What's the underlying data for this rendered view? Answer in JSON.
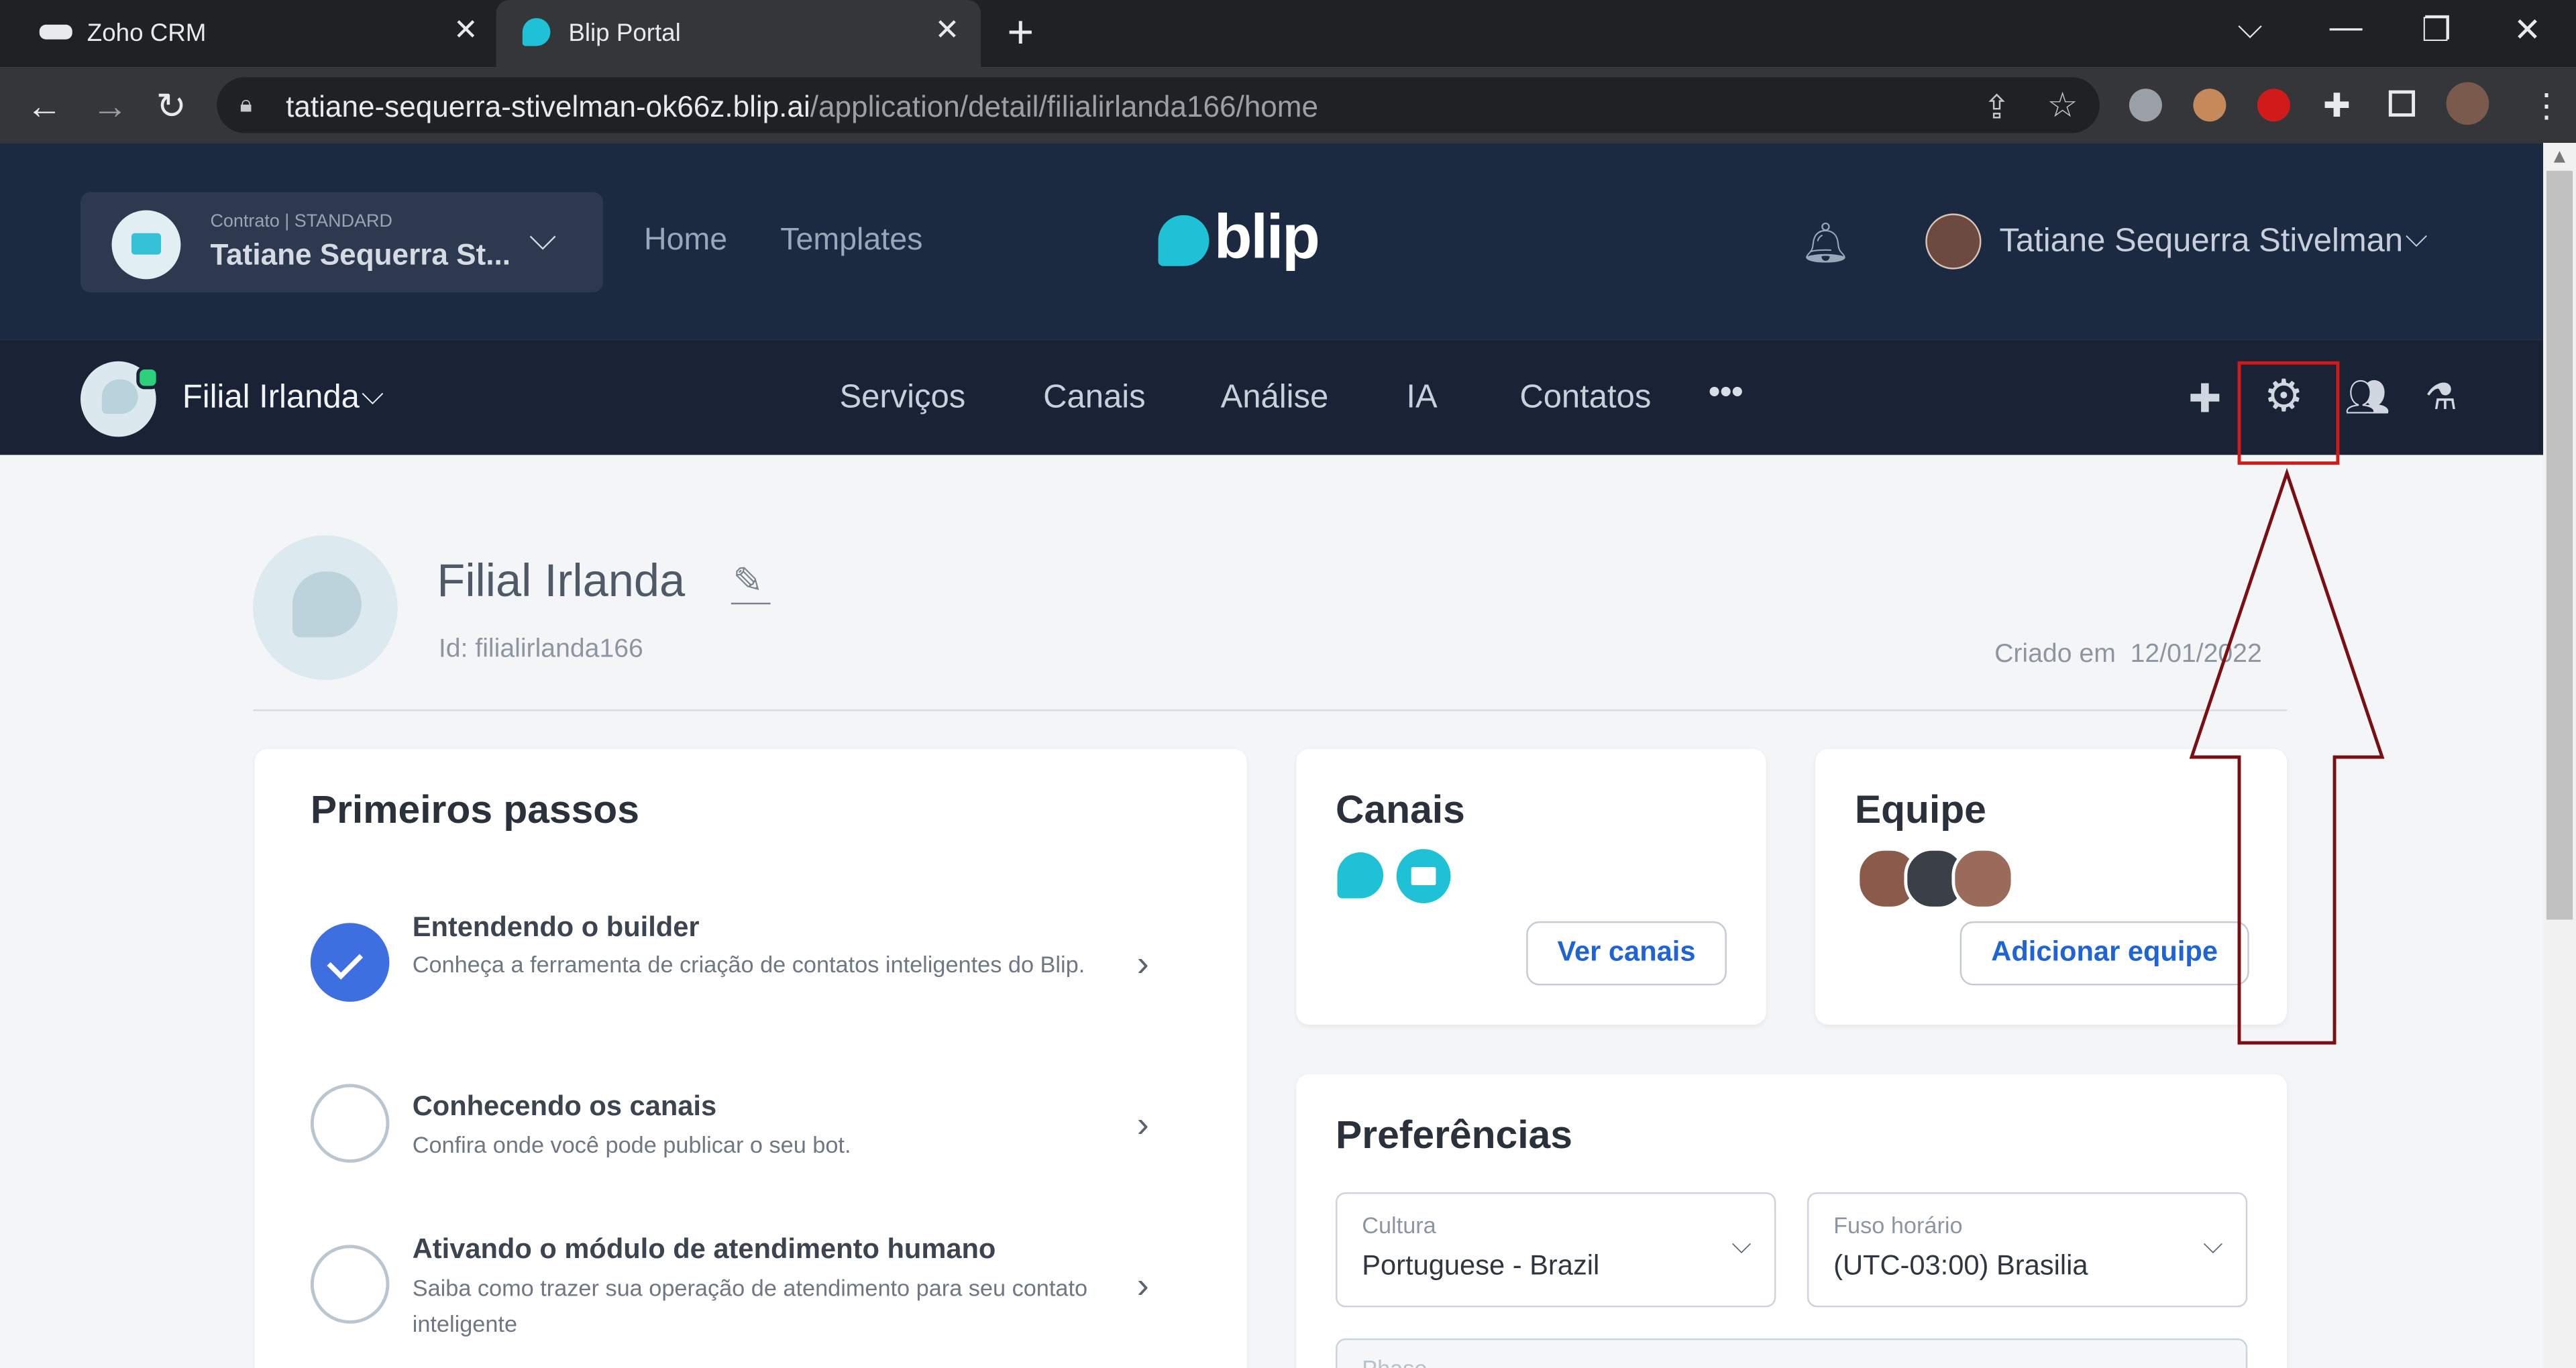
{
  "browser": {
    "tabs": [
      {
        "title": "Zoho CRM",
        "favicon": "blip-logo"
      },
      {
        "title": "Blip Portal",
        "favicon": "blip-bubble"
      }
    ],
    "url_host": "tatiane-sequerra-stivelman-ok66z.blip.ai",
    "url_path": "/application/detail/filialirlanda166/home",
    "new_tab_glyph": "+",
    "close_glyph": "✕"
  },
  "header": {
    "contract_label": "Contrato | STANDARD",
    "contract_name": "Tatiane Sequerra St...",
    "nav": [
      "Home",
      "Templates"
    ],
    "logo_text": "blip",
    "user_name": "Tatiane Sequerra Stivelman"
  },
  "botbar": {
    "bot_name": "Filial Irlanda",
    "nav": [
      "Serviços",
      "Canais",
      "Análise",
      "IA",
      "Contatos"
    ],
    "more_glyph": "•••"
  },
  "profile": {
    "title": "Filial Irlanda",
    "id_text": "Id: filialirlanda166",
    "created_label": "Criado em",
    "created_date": "12/01/2022"
  },
  "first_steps": {
    "title": "Primeiros passos",
    "steps": [
      {
        "title": "Entendendo o builder",
        "desc": "Conheça a ferramenta de criação de contatos inteligentes do Blip.",
        "done": true
      },
      {
        "title": "Conhecendo os canais",
        "desc": "Confira onde você pode publicar o seu bot.",
        "done": false
      },
      {
        "title": "Ativando o módulo de atendimento humano",
        "desc": "Saiba como trazer sua operação de atendimento para seu contato inteligente",
        "done": false
      }
    ]
  },
  "channels": {
    "title": "Canais",
    "button": "Ver canais"
  },
  "team": {
    "title": "Equipe",
    "button": "Adicionar equipe"
  },
  "preferences": {
    "title": "Preferências",
    "culture_label": "Cultura",
    "culture_value": "Portuguese - Brazil",
    "timezone_label": "Fuso horário",
    "timezone_value": "(UTC-03:00) Brasilia",
    "partial_label": "Phase"
  },
  "colors": {
    "accent": "#1f64d6",
    "brand": "#1ec1d6",
    "annotation": "#7a0e12",
    "header_bg": "#1c2a41"
  }
}
